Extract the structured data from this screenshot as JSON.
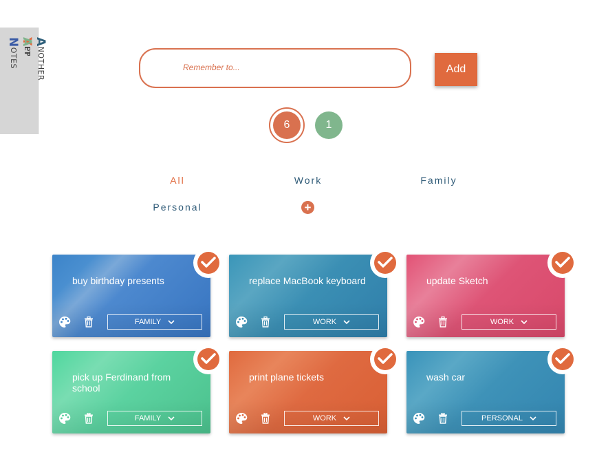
{
  "logo": {
    "col1": {
      "cap1": "Y",
      "word1": "ET",
      "cap2": "N",
      "word2": "OTES"
    },
    "col2": {
      "cap1": "A",
      "word1": "NOTHER",
      "cap2": "A",
      "word2": "PP"
    }
  },
  "form": {
    "placeholder": "Remember to...",
    "value": "",
    "add_label": "Add"
  },
  "counters": {
    "todo": "6",
    "done": "1"
  },
  "filters": [
    {
      "label": "All",
      "active": true
    },
    {
      "label": "Work",
      "active": false
    },
    {
      "label": "Family",
      "active": false
    },
    {
      "label": "Personal",
      "active": false
    }
  ],
  "add_category_label": "+",
  "colors": {
    "accent": "#e06a3e",
    "done": "#80b68d",
    "filter_text": "#2e5a77"
  },
  "notes": [
    {
      "title": "buy birthday presents",
      "category": "FAMILY",
      "color": "blue",
      "done_icon": "check-icon"
    },
    {
      "title": "replace MacBook keyboard",
      "category": "WORK",
      "color": "teal",
      "done_icon": "check-icon"
    },
    {
      "title": "update Sketch",
      "category": "WORK",
      "color": "pink",
      "done_icon": "check-icon"
    },
    {
      "title": "pick up Ferdinand from school",
      "category": "FAMILY",
      "color": "green",
      "done_icon": "check-icon"
    },
    {
      "title": "print plane tickets",
      "category": "WORK",
      "color": "orange",
      "done_icon": "check-icon"
    },
    {
      "title": "wash car",
      "category": "PERSONAL",
      "color": "teal",
      "done_icon": "check-icon"
    }
  ],
  "icons": [
    "palette-icon",
    "trash-icon",
    "chevron-down-icon",
    "check-icon",
    "plus-icon"
  ]
}
